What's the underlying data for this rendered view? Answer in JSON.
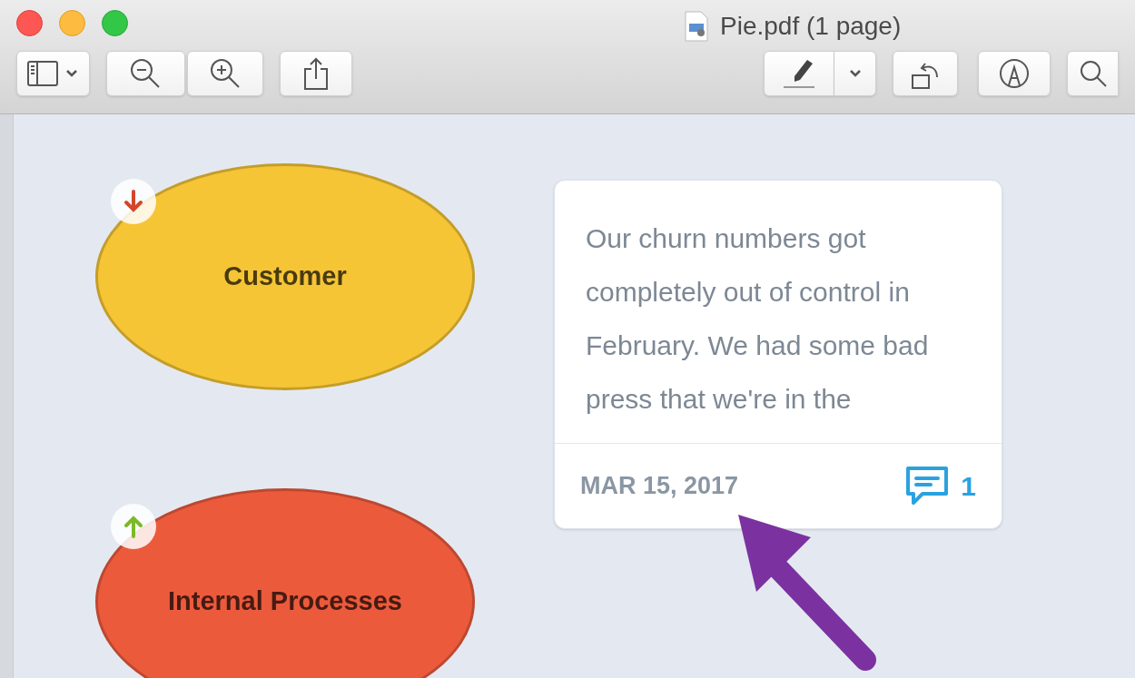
{
  "window": {
    "title": "Pie.pdf (1 page)"
  },
  "nodes": [
    {
      "label": "Customer",
      "color": "#f6c535",
      "kind": "down"
    },
    {
      "label": "Internal Processes",
      "color": "#ec5a3c",
      "kind": "up"
    }
  ],
  "card": {
    "text": "Our churn numbers got completely out of control in February. We had some bad press that we're in the",
    "date": "MAR 15, 2017",
    "comments": "1"
  }
}
